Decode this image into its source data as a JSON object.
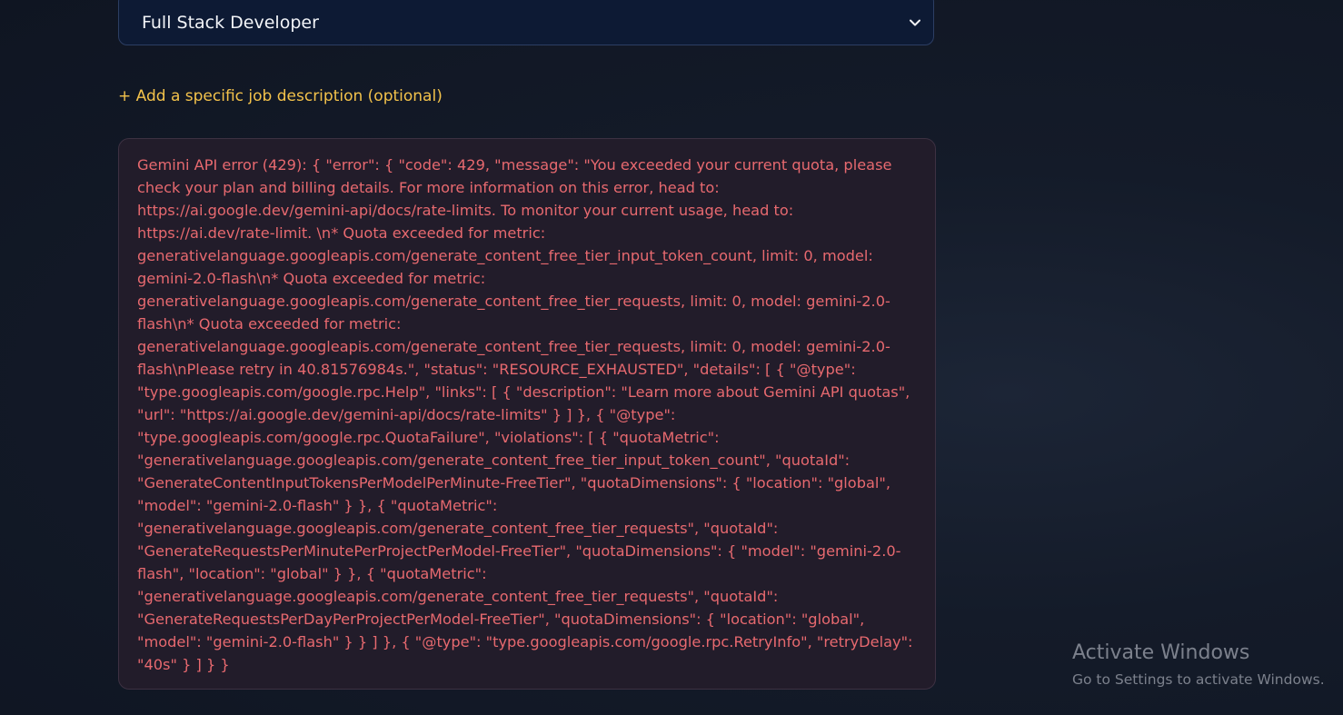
{
  "role_select": {
    "selected": "Full Stack Developer",
    "icon": "chevron-down-icon"
  },
  "add_job_description_link": "+ Add a specific job description (optional)",
  "error": {
    "message": "Gemini API error (429): { \"error\": { \"code\": 429, \"message\": \"You exceeded your current quota, please check your plan and billing details. For more information on this error, head to: https://ai.google.dev/gemini-api/docs/rate-limits. To monitor your current usage, head to: https://ai.dev/rate-limit. \\n* Quota exceeded for metric: generativelanguage.googleapis.com/generate_content_free_tier_input_token_count, limit: 0, model: gemini-2.0-flash\\n* Quota exceeded for metric: generativelanguage.googleapis.com/generate_content_free_tier_requests, limit: 0, model: gemini-2.0-flash\\n* Quota exceeded for metric: generativelanguage.googleapis.com/generate_content_free_tier_requests, limit: 0, model: gemini-2.0-flash\\nPlease retry in 40.81576984s.\", \"status\": \"RESOURCE_EXHAUSTED\", \"details\": [ { \"@type\": \"type.googleapis.com/google.rpc.Help\", \"links\": [ { \"description\": \"Learn more about Gemini API quotas\", \"url\": \"https://ai.google.dev/gemini-api/docs/rate-limits\" } ] }, { \"@type\": \"type.googleapis.com/google.rpc.QuotaFailure\", \"violations\": [ { \"quotaMetric\": \"generativelanguage.googleapis.com/generate_content_free_tier_input_token_count\", \"quotaId\": \"GenerateContentInputTokensPerModelPerMinute-FreeTier\", \"quotaDimensions\": { \"location\": \"global\", \"model\": \"gemini-2.0-flash\" } }, { \"quotaMetric\": \"generativelanguage.googleapis.com/generate_content_free_tier_requests\", \"quotaId\": \"GenerateRequestsPerMinutePerProjectPerModel-FreeTier\", \"quotaDimensions\": { \"model\": \"gemini-2.0-flash\", \"location\": \"global\" } }, { \"quotaMetric\": \"generativelanguage.googleapis.com/generate_content_free_tier_requests\", \"quotaId\": \"GenerateRequestsPerDayPerProjectPerModel-FreeTier\", \"quotaDimensions\": { \"location\": \"global\", \"model\": \"gemini-2.0-flash\" } } ] }, { \"@type\": \"type.googleapis.com/google.rpc.RetryInfo\", \"retryDelay\": \"40s\" } ] } }"
  },
  "windows_watermark": {
    "title": "Activate Windows",
    "subtitle": "Go to Settings to activate Windows."
  },
  "colors": {
    "background": "#141b29",
    "select_bg": "#0d1a34",
    "link": "#f3c24b",
    "error_text": "#e7696f",
    "error_bg": "#221c2a"
  }
}
